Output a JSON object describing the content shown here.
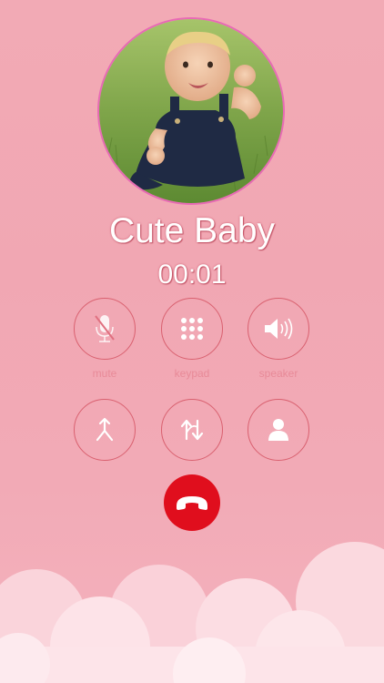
{
  "caller": {
    "name": "Cute Baby",
    "duration": "00:01"
  },
  "controls": [
    {
      "label": "mute",
      "icon": "microphone-muted-icon"
    },
    {
      "label": "keypad",
      "icon": "keypad-icon"
    },
    {
      "label": "speaker",
      "icon": "speaker-icon"
    },
    {
      "label": "",
      "icon": "merge-calls-icon"
    },
    {
      "label": "",
      "icon": "swap-calls-icon"
    },
    {
      "label": "",
      "icon": "contacts-icon"
    }
  ],
  "end_call": {
    "icon": "end-call-icon",
    "color": "#e00e1d"
  },
  "theme": {
    "background": "#f2aab5",
    "control_stroke": "#d9606f",
    "avatar_border": "#e86ab5"
  }
}
